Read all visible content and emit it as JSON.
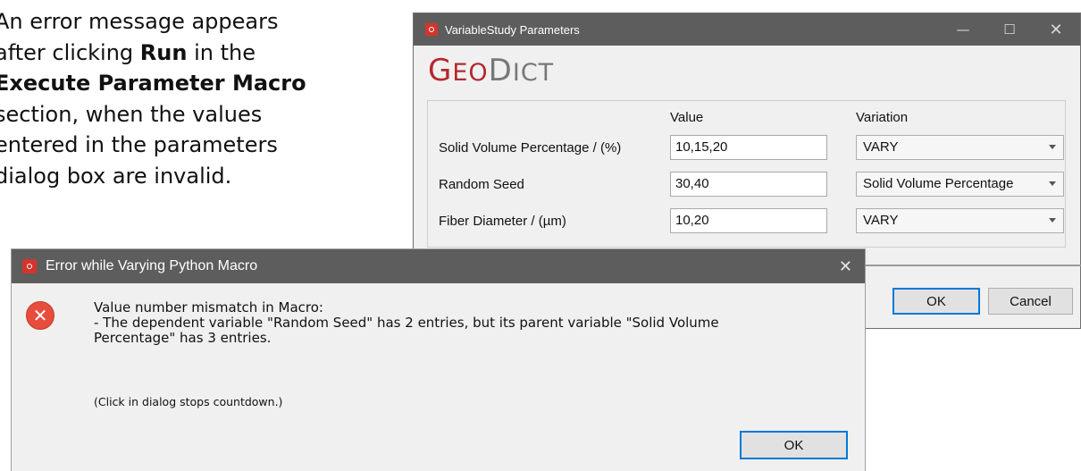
{
  "doc": {
    "line1": "An error message appears",
    "line2_pre": "after clicking ",
    "line2_bold": "Run",
    "line2_post": " in the",
    "line3_bold": "Execute Parameter Macro",
    "line4": "section, when the values",
    "line5": "entered in the parameters",
    "line6": "dialog box are invalid."
  },
  "param_window": {
    "title": "VariableStudy Parameters",
    "logo_part1": "G",
    "logo_part2": "EO",
    "logo_part3": "D",
    "logo_part4": "ICT",
    "col_value": "Value",
    "col_variation": "Variation",
    "rows": [
      {
        "label": "Solid Volume Percentage / (%)",
        "value": "10,15,20",
        "variation": "VARY"
      },
      {
        "label": "Random Seed",
        "value": "30,40",
        "variation": "Solid Volume Percentage"
      },
      {
        "label": "Fiber Diameter / (µm)",
        "value": "10,20",
        "variation": "VARY"
      }
    ],
    "ok_label": "OK",
    "cancel_label": "Cancel"
  },
  "error_dialog": {
    "title": "Error while Varying Python Macro",
    "message": "Value number mismatch in Macro:\n - The dependent variable \"Random Seed\" has 2 entries, but its parent variable \"Solid Volume\nPercentage\" has  3 entries.",
    "hint": "(Click in dialog stops countdown.)",
    "ok_label": "OK"
  }
}
